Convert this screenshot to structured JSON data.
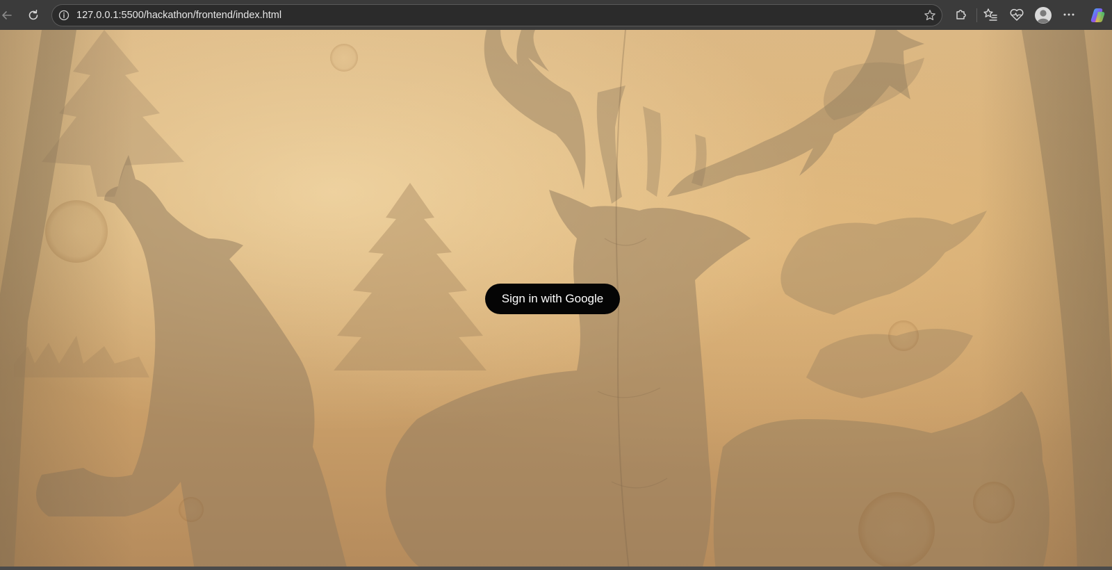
{
  "browser": {
    "url": "127.0.0.1:5500/hackathon/frontend/index.html",
    "icons": {
      "back": "back-arrow-icon",
      "refresh": "refresh-icon",
      "info": "info-icon",
      "favorite": "star-icon",
      "extensions": "puzzle-icon",
      "favorites": "favorites-list-icon",
      "health": "heart-pulse-icon",
      "profile": "profile-avatar-icon",
      "menu": "more-dots-icon",
      "copilot": "copilot-icon"
    }
  },
  "page": {
    "signin_label": "Sign in with Google",
    "background_colors": {
      "paper_light": "#e8c892",
      "paper_dark": "#b58b5c",
      "silhouette": "#8f7a5e"
    },
    "button_color": "#050505"
  }
}
